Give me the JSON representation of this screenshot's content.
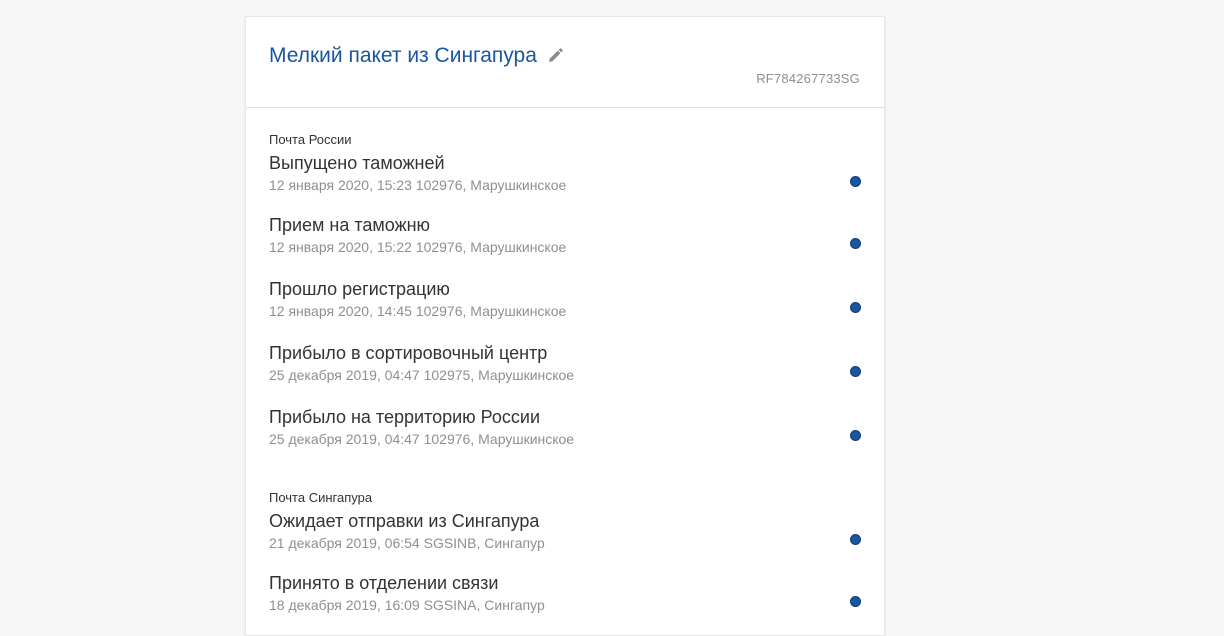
{
  "parcel": {
    "title": "Мелкий пакет из Сингапура",
    "tracking_number": "RF784267733SG"
  },
  "colors": {
    "accent": "#1a56a0",
    "text": "#333333",
    "muted": "#8f8f8f",
    "background": "#f7f7f7"
  },
  "icons": {
    "edit": "pencil-icon",
    "status": "dot-icon"
  },
  "groups": [
    {
      "carrier": "Почта России",
      "events": [
        {
          "status": "Выпущено таможней",
          "meta": "12 января 2020, 15:23 102976, Марушкинское"
        },
        {
          "status": "Прием на таможню",
          "meta": "12 января 2020, 15:22 102976, Марушкинское"
        },
        {
          "status": "Прошло регистрацию",
          "meta": "12 января 2020, 14:45 102976, Марушкинское"
        },
        {
          "status": "Прибыло в сортировочный центр",
          "meta": "25 декабря 2019, 04:47 102975, Марушкинское"
        },
        {
          "status": "Прибыло на территорию России",
          "meta": "25 декабря 2019, 04:47 102976, Марушкинское"
        }
      ]
    },
    {
      "carrier": "Почта Сингапура",
      "events": [
        {
          "status": "Ожидает отправки из Сингапура",
          "meta": "21 декабря 2019, 06:54 SGSINB, Сингапур"
        },
        {
          "status": "Принято в отделении связи",
          "meta": "18 декабря 2019, 16:09 SGSINA, Сингапур"
        }
      ]
    }
  ]
}
